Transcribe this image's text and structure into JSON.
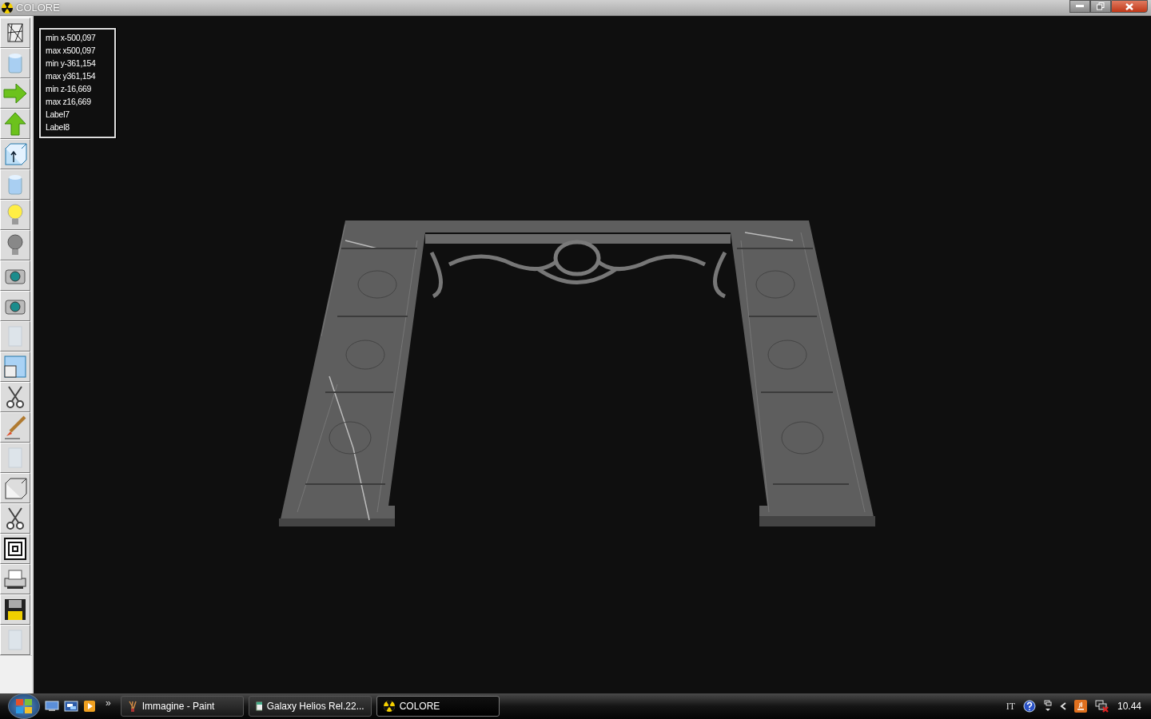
{
  "window": {
    "title": "COLORE"
  },
  "info_labels": [
    "min x-500,097",
    "max x500,097",
    "min y-361,154",
    "max y361,154",
    "min z-16,669",
    "max z16,669",
    "Label7",
    "Label8"
  ],
  "taskbar": {
    "quick_launch_more": "»",
    "tasks": [
      {
        "label": "Immagine - Paint",
        "selected": false
      },
      {
        "label": "Galaxy Helios  Rel.22...",
        "selected": false
      },
      {
        "label": "COLORE",
        "selected": true
      }
    ],
    "language": "IT",
    "clock": "10.44"
  }
}
